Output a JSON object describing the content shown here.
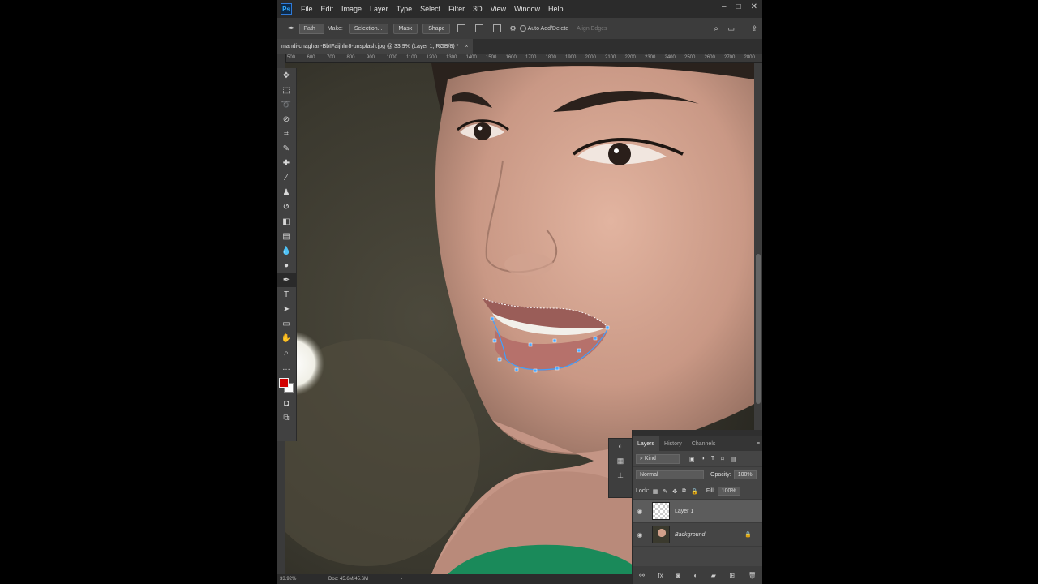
{
  "app": {
    "logo_text": "Ps"
  },
  "menu": {
    "items": [
      "File",
      "Edit",
      "Image",
      "Layer",
      "Type",
      "Select",
      "Filter",
      "3D",
      "View",
      "Window",
      "Help"
    ]
  },
  "window_controls": [
    "–",
    "□",
    "✕"
  ],
  "options_bar": {
    "mode": "Path",
    "make_label": "Make:",
    "selection_button": "Selection...",
    "mask_button": "Mask",
    "shape_button": "Shape",
    "auto_add_delete": "Auto Add/Delete",
    "align_edges": "Align Edges"
  },
  "document_tab": {
    "title": "mahdi-chaghari-BbIFaijhhr8-unsplash.jpg @ 33.9% (Layer 1, RGB/8) *",
    "close": "×"
  },
  "ruler": {
    "ticks": [
      "500",
      "600",
      "700",
      "800",
      "900",
      "1000",
      "1100",
      "1200",
      "1300",
      "1400",
      "1500",
      "1600",
      "1700",
      "1800",
      "1900",
      "2000",
      "2100",
      "2200",
      "2300",
      "2400",
      "2500",
      "2600",
      "2700",
      "2800"
    ]
  },
  "colors": {
    "foreground": "#d10000",
    "background": "#ffffff",
    "accent": "#31a8ff"
  },
  "status_bar": {
    "zoom": "33.92%",
    "doc": "Doc: 45.6M/45.6M",
    "arrow": "›"
  },
  "layers_panel": {
    "tabs": [
      "Layers",
      "History",
      "Channels"
    ],
    "filter_kind": "Kind",
    "blend_mode": "Normal",
    "opacity_label": "Opacity:",
    "opacity_value": "100%",
    "lock_label": "Lock:",
    "fill_label": "Fill:",
    "fill_value": "100%",
    "layers": [
      {
        "name": "Layer 1",
        "selected": true
      },
      {
        "name": "Background",
        "selected": false,
        "locked": true
      }
    ]
  }
}
